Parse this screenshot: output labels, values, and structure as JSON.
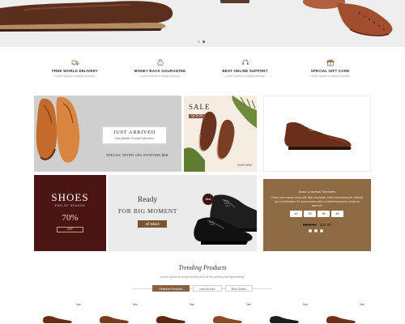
{
  "colors": {
    "brand_brown": "#8a6140",
    "dark_maroon": "#4a1512",
    "offer_tan": "#8f6b45"
  },
  "hero": {
    "slider_dots": 2,
    "active_dot": 2
  },
  "features": [
    {
      "icon": "truck-icon",
      "title": "FREE WORLD DELIVERY",
      "sub": "Lorem Ipsum is simply dummy"
    },
    {
      "icon": "money-bag-icon",
      "title": "MONEY BACK GAURANTEE",
      "sub": "Lorem Ipsum is simply dummy"
    },
    {
      "icon": "support-icon",
      "title": "BEST ONLINE SUPPORT",
      "sub": "Lorem Ipsum is simply dummy"
    },
    {
      "icon": "gift-icon",
      "title": "SPECIAL GIFT CARD",
      "sub": "Lorem Ipsum is simply dummy"
    }
  ],
  "banners": {
    "just_arrived": {
      "title": "JUST ARRIVED",
      "subtitle": "New Bakelie Formal Collections",
      "offer": "SPECIAL OFFER 10% STARTING $99"
    },
    "sale": {
      "title": "SALE",
      "tag": "Up To Off",
      "shop_link": "SHOP NOW"
    },
    "shoes": {
      "title": "SHOES",
      "subtitle": "END OF SEASON",
      "percent": "70%",
      "button": "OFF"
    },
    "ready": {
      "line1": "Ready",
      "line2": "FOR BIG MOMENT",
      "button": "All Black",
      "badge": "New"
    },
    "deal": {
      "title": "Basic Universal Sneakers",
      "description": "Fusce sem massa risus with high resolution, Italia and among its material by a combination Dr. Accessories with a sneakerhead your ready for summer!",
      "timer": [
        "43",
        "05",
        "55",
        "48"
      ],
      "old_price": "$100.00",
      "new_price": "$44.00"
    }
  },
  "trending": {
    "title": "Trending Products",
    "subtitle": "Lorem Ipsum is simply dummy text of the printing and typesetting.",
    "tabs": [
      "Featured Products",
      "New Arrivals",
      "Best Sellers"
    ],
    "active_tab": 0,
    "badges": [
      "Sale",
      "New",
      "Sale",
      "Sale",
      "New",
      "Sale"
    ]
  }
}
